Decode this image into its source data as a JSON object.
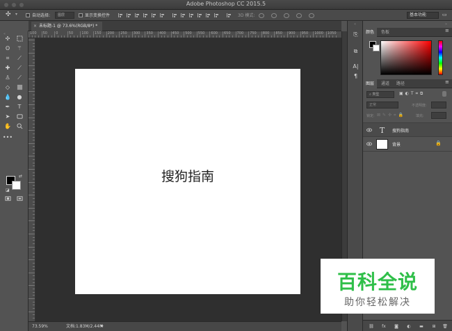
{
  "window": {
    "title": "Adobe Photoshop CC 2015.5"
  },
  "options_bar": {
    "auto_select_label": "自动选择:",
    "auto_select_value": "图层",
    "show_transform_label": "显示变换控件",
    "mode_3d_label": "3D 模式:",
    "workspace": "基本功能"
  },
  "document": {
    "tab_title": "未标题-1 @ 73.6%(RGB/8*) *",
    "text_layer_content": "搜狗指南"
  },
  "ruler": {
    "top_labels": [
      "100",
      "50",
      "0",
      "50",
      "100",
      "150",
      "200",
      "250",
      "300",
      "350",
      "400",
      "450",
      "500",
      "550",
      "600",
      "650",
      "700",
      "750",
      "800",
      "850",
      "900",
      "950",
      "1000",
      "1050"
    ]
  },
  "status": {
    "zoom": "73.59%",
    "doc_size": "文档:1.83M/2.44M"
  },
  "panels": {
    "color_tabs": [
      "颜色",
      "色板"
    ],
    "layer_tabs": [
      "图层",
      "通道",
      "路径"
    ],
    "kind_filter": "类型",
    "blend_mode": "正常",
    "opacity_label": "不透明度:",
    "lock_label": "锁定:",
    "fill_label": "填充:",
    "layers": [
      {
        "name": "搜狗指南",
        "kind": "text"
      },
      {
        "name": "背景",
        "kind": "background"
      }
    ]
  },
  "watermark": {
    "title": "百科全说",
    "subtitle": "助你轻松解决"
  }
}
